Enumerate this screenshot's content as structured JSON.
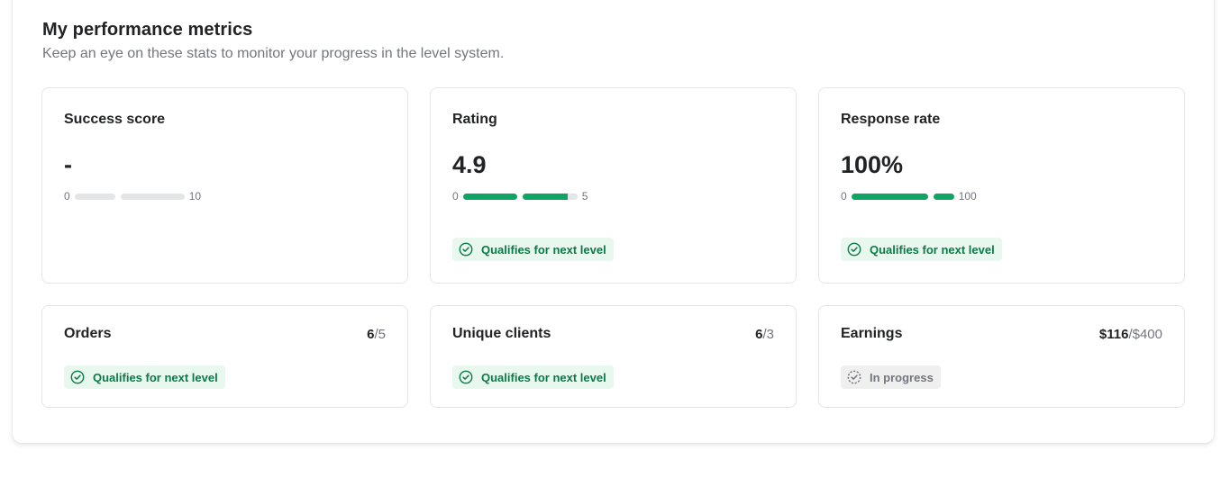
{
  "header": {
    "title": "My performance metrics",
    "subtitle": "Keep an eye on these stats to monitor your progress in the level system."
  },
  "colors": {
    "success_green": "#0fa463",
    "badge_green_bg": "#e8f8ef",
    "neutral_bar": "#e4e5e7"
  },
  "metrics": {
    "success_score": {
      "title": "Success score",
      "value": "-",
      "scale_min": "0",
      "scale_max": "10"
    },
    "rating": {
      "title": "Rating",
      "value": "4.9",
      "scale_min": "0",
      "scale_max": "5",
      "badge": "Qualifies for next level"
    },
    "response_rate": {
      "title": "Response rate",
      "value": "100%",
      "scale_min": "0",
      "scale_max": "100",
      "badge": "Qualifies for next level"
    },
    "orders": {
      "title": "Orders",
      "current": "6",
      "target": "/5",
      "badge": "Qualifies for next level"
    },
    "unique_clients": {
      "title": "Unique clients",
      "current": "6",
      "target": "/3",
      "badge": "Qualifies for next level"
    },
    "earnings": {
      "title": "Earnings",
      "current": "$116",
      "target": "/$400",
      "badge": "In progress"
    }
  },
  "icons": {
    "qualified": "check-circle-icon",
    "in_progress": "dashed-check-circle-icon"
  }
}
